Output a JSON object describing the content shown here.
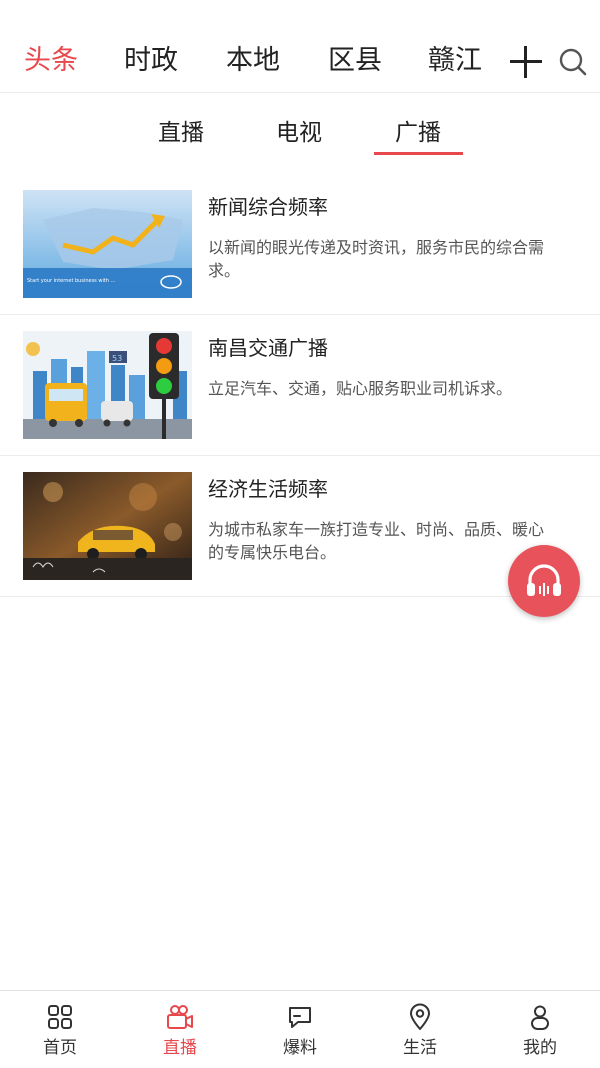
{
  "header": {
    "tabs": [
      {
        "label": "头条",
        "active": true
      },
      {
        "label": "时政",
        "active": false
      },
      {
        "label": "本地",
        "active": false
      },
      {
        "label": "区县",
        "active": false
      },
      {
        "label": "赣江",
        "active": false
      }
    ],
    "icons": [
      "plus-icon",
      "search-icon"
    ]
  },
  "sub_tabs": [
    {
      "label": "直播",
      "active": false
    },
    {
      "label": "电视",
      "active": false
    },
    {
      "label": "广播",
      "active": true
    }
  ],
  "channels": [
    {
      "title": "新闻综合频率",
      "desc": "以新闻的眼光传递及时资讯，服务市民的综合需求。",
      "thumb": "news-chart-thumbnail",
      "thumb_text": "Start your internet business with ..."
    },
    {
      "title": "南昌交通广播",
      "desc": "立足汽车、交通，贴心服务职业司机诉求。",
      "thumb": "traffic-light-city-thumbnail",
      "thumb_text": "53"
    },
    {
      "title": "经济生活频率",
      "desc": "为城市私家车一族打造专业、时尚、品质、暖心的专属快乐电台。",
      "thumb": "rainy-taxi-night-thumbnail"
    }
  ],
  "fab": {
    "icon": "headphones-icon"
  },
  "bottom_nav": [
    {
      "label": "首页",
      "icon": "grid-icon",
      "active": false
    },
    {
      "label": "直播",
      "icon": "video-camera-icon",
      "active": true
    },
    {
      "label": "爆料",
      "icon": "chat-bubble-icon",
      "active": false
    },
    {
      "label": "生活",
      "icon": "location-pin-icon",
      "active": false
    },
    {
      "label": "我的",
      "icon": "user-icon",
      "active": false
    }
  ],
  "colors": {
    "accent": "#e8474c",
    "fab": "#e8525a",
    "text": "#222222",
    "divider": "#ececec"
  }
}
